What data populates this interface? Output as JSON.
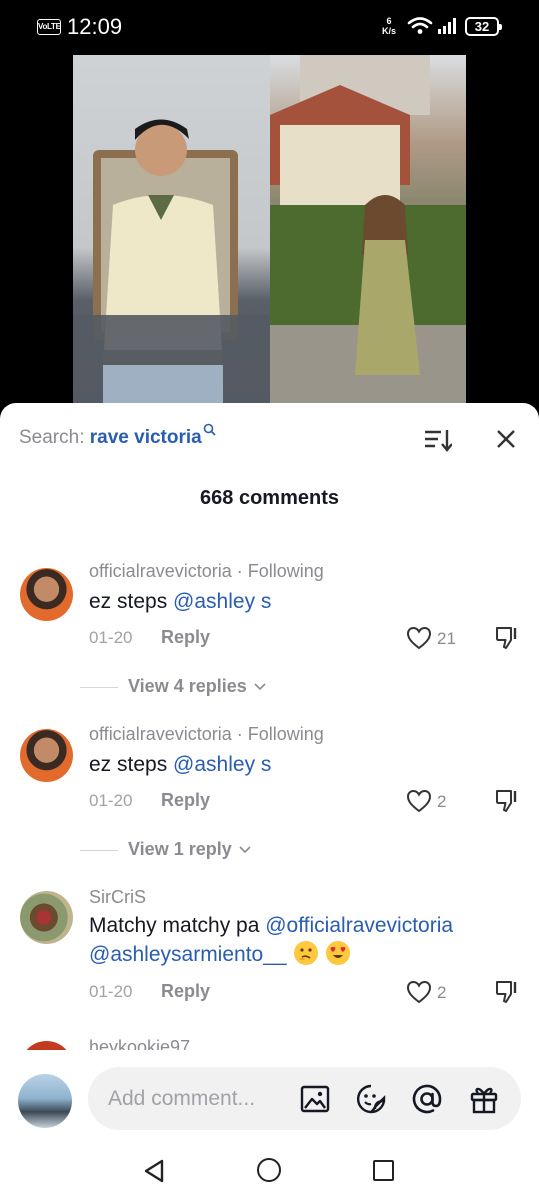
{
  "status_bar": {
    "volte": "VoLTE",
    "time": "12:09",
    "net_speed_value": "6",
    "net_speed_unit": "K/s",
    "battery": "32"
  },
  "video": {
    "icons": [
      "video-frame-left",
      "video-frame-right"
    ]
  },
  "sheet": {
    "search_label": "Search:",
    "search_query": "rave victoria",
    "comment_count": "668 comments"
  },
  "comments": [
    {
      "username": "officialravevictoria",
      "tag": " · Following",
      "text": "ez steps ",
      "mention": "@ashley s",
      "date": "01-20",
      "reply": "Reply",
      "likes": "21",
      "view_replies": "View 4 replies"
    },
    {
      "username": "officialravevictoria",
      "tag": " · Following",
      "text": "ez steps ",
      "mention": "@ashley s",
      "date": "01-20",
      "reply": "Reply",
      "likes": "2",
      "view_replies": "View 1 reply"
    },
    {
      "username": "SirCriS",
      "text": "Matchy matchy pa ",
      "mention": "@officialravevictoria",
      "mention2": "@ashleysarmiento__",
      "date": "01-20",
      "reply": "Reply",
      "likes": "2"
    },
    {
      "username": "heykookie97"
    }
  ],
  "input_bar": {
    "placeholder": "Add comment..."
  },
  "colors": {
    "mention": "#2a5db0",
    "muted": "#8a8b91",
    "text": "#161823"
  }
}
